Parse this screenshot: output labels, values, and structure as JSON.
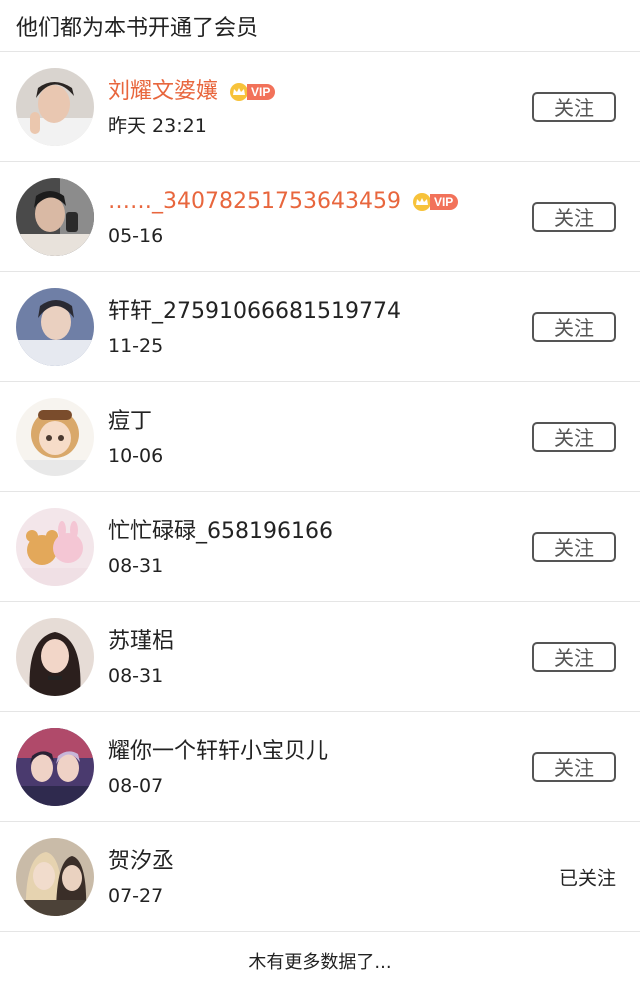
{
  "header": {
    "title": "他们都为本书开通了会员"
  },
  "members": [
    {
      "name": "刘耀文婆孃",
      "date": "昨天 23:21",
      "vip": true,
      "vip_label": "VIP",
      "action": "关注"
    },
    {
      "name": "……_34078251753643459",
      "date": "05-16",
      "vip": true,
      "vip_label": "VIP",
      "action": "关注"
    },
    {
      "name": "轩轩_27591066681519774",
      "date": "11-25",
      "vip": false,
      "action": "关注"
    },
    {
      "name": "痘丁",
      "date": "10-06",
      "vip": false,
      "action": "关注"
    },
    {
      "name": "忙忙碌碌_658196166",
      "date": "08-31",
      "vip": false,
      "action": "关注"
    },
    {
      "name": "苏瑾梠",
      "date": "08-31",
      "vip": false,
      "action": "关注"
    },
    {
      "name": "耀你一个轩轩小宝贝儿",
      "date": "08-07",
      "vip": false,
      "action": "关注"
    },
    {
      "name": "贺汐丞",
      "date": "07-27",
      "vip": false,
      "action": "已关注"
    }
  ],
  "footer": {
    "text": "木有更多数据了..."
  },
  "colors": {
    "vip_name": "#e8663d",
    "vip_tag": "#f2725a",
    "button_border": "#555555",
    "divider": "#e5e5e5"
  }
}
